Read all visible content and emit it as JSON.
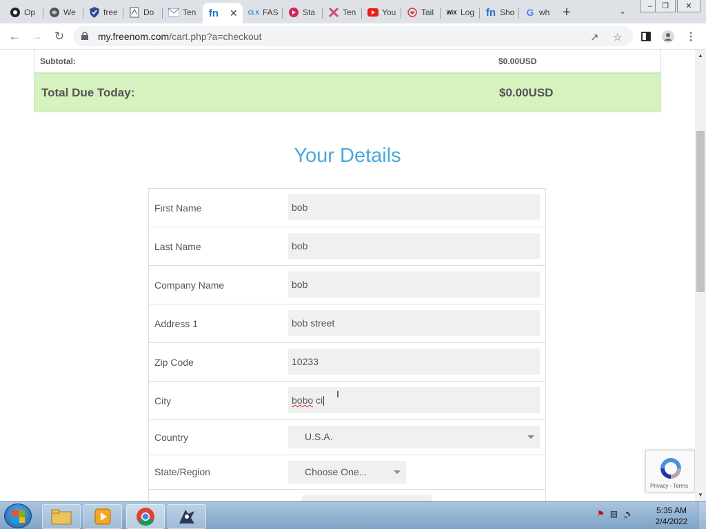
{
  "browser": {
    "tabs": [
      {
        "title": "Op",
        "icon": "github-icon"
      },
      {
        "title": "We",
        "icon": "globe-icon"
      },
      {
        "title": "free",
        "icon": "shield-icon"
      },
      {
        "title": "Do",
        "icon": "document-icon"
      },
      {
        "title": "Ten",
        "icon": "mail-icon"
      },
      {
        "title": "",
        "icon": "freenom-icon",
        "active": true
      },
      {
        "title": "FAS",
        "icon": "click-icon"
      },
      {
        "title": "Sta",
        "icon": "record-icon"
      },
      {
        "title": "Ten",
        "icon": "x-icon"
      },
      {
        "title": "You",
        "icon": "youtube-icon"
      },
      {
        "title": "Tail",
        "icon": "heart-icon"
      },
      {
        "title": "Log",
        "icon": "wix-icon"
      },
      {
        "title": "Sho",
        "icon": "freenom-icon"
      },
      {
        "title": "wh",
        "icon": "google-icon"
      }
    ],
    "url_host": "my.freenom.com",
    "url_path": "/cart.php?a=checkout"
  },
  "summary": {
    "subtotal_label": "Subtotal:",
    "subtotal_value": "$0.00USD",
    "total_label": "Total Due Today:",
    "total_value": "$0.00USD",
    "total_bg": "#d6f2bf"
  },
  "details": {
    "title": "Your Details",
    "title_color": "#4aa8d8",
    "fields": {
      "first_name": {
        "label": "First Name",
        "value": "bob"
      },
      "last_name": {
        "label": "Last Name",
        "value": "bob"
      },
      "company": {
        "label": "Company Name",
        "value": "bob"
      },
      "address1": {
        "label": "Address 1",
        "value": "bob street"
      },
      "zip": {
        "label": "Zip Code",
        "value": "10233"
      },
      "city": {
        "label": "City",
        "value_a": "bobo",
        "value_b": " ci"
      },
      "country": {
        "label": "Country",
        "value": "U.S.A."
      },
      "state": {
        "label": "State/Region",
        "value": "Choose One..."
      }
    }
  },
  "recaptcha": {
    "links": "Privacy - Terms"
  },
  "taskbar": {
    "time": "5:35 AM",
    "date": "2/4/2022"
  }
}
